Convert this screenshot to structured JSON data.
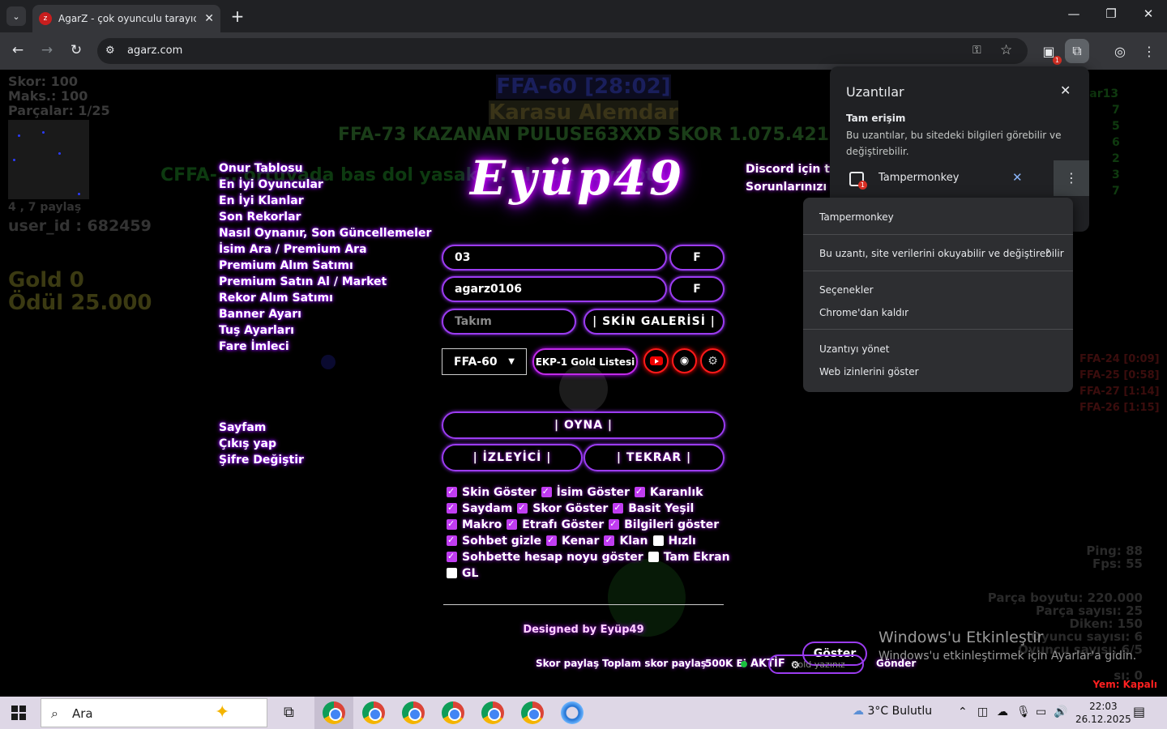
{
  "browser": {
    "tab_title": "AgarZ - çok oyunculu tarayıcı oyunu",
    "tab_close": "✕",
    "new_tab": "+",
    "url": "agarz.com",
    "window_controls": {
      "minimize": "—",
      "maximize": "❐",
      "close": "✕"
    },
    "extension_badge": "1"
  },
  "game": {
    "skor": "Skor: 100",
    "maks": "Maks.: 100",
    "parcalar": "Parçalar: 1/25",
    "share_text": "4 , 7 paylaş",
    "user_id": "user_id : 682459",
    "gold": "Gold 0",
    "odul": "Ödül 25.000",
    "server_title": "FFA-60 [28:02]",
    "karasu": "Karasu Alemdar",
    "winner_banner": "FFA-73 KAZANAN PULUSE63XXD SKOR 1.075.421",
    "ticker": "CFFA-... ortuvada bas dol yasakt... olmak veya oto",
    "logo": "Eyüp49",
    "menu_top": [
      "Onur Tablosu",
      "En İyi Oyuncular",
      "En İyi Klanlar",
      "Son Rekorlar",
      "Nasıl Oynanır, Son Güncellemeler",
      "İsim Ara / Premium Ara",
      "Premium Alım Satımı",
      "Premium Satın Al / Market",
      "Rekor Alım Satımı",
      "Banner Ayarı",
      "Tuş Ayarları",
      "Fare İmleci"
    ],
    "menu_bottom": [
      "Sayfam",
      "Çıkış yap",
      "Şifre Değiştir"
    ],
    "discord_line1": "Discord için tıkl",
    "discord_line2": "Sorunlarınızı bi",
    "tag_value": "03",
    "f_button": "F",
    "nick_value": "agarz0106",
    "team_placeholder": "Takım",
    "skin_gallery": "| SKİN GALERİSİ |",
    "server_select": "FFA-60",
    "gold_list": "EKP-1 Gold Listesi",
    "play": "| OYNA |",
    "spectate": "| İZLEYİCİ |",
    "replay": "| TEKRAR |",
    "checkbox_rows": [
      [
        {
          "label": "Skin Göster",
          "on": true
        },
        {
          "label": "İsim Göster",
          "on": true
        },
        {
          "label": "Karanlık",
          "on": true
        }
      ],
      [
        {
          "label": "Saydam",
          "on": true
        },
        {
          "label": "Skor Göster",
          "on": true
        },
        {
          "label": "Basit Yeşil",
          "on": true
        }
      ],
      [
        {
          "label": "Makro",
          "on": true
        },
        {
          "label": "Etrafı Göster",
          "on": true
        },
        {
          "label": "Bilgileri göster",
          "on": true
        }
      ],
      [
        {
          "label": "Sohbet gizle",
          "on": true
        },
        {
          "label": "Kenar",
          "on": true
        },
        {
          "label": "Klan",
          "on": true
        },
        {
          "label": "Hızlı",
          "on": false
        }
      ],
      [
        {
          "label": "Sohbette hesap noyu göster",
          "on": true
        },
        {
          "label": "Tam Ekran",
          "on": false
        }
      ],
      [
        {
          "label": "GL",
          "on": false
        }
      ]
    ],
    "designed_by": "Designed by Eyüp49",
    "skor_paylas": "Skor paylaş",
    "toplam_skor_paylas": "Toplam skor paylaş",
    "k500": "500K Ei",
    "aktif": "AKTİF",
    "chat_placeholder": "Gold yazınız",
    "gonder": "Gönder",
    "goster": "Göster",
    "leaderboard_right": [
      "aglar13",
      "7",
      "5",
      "6",
      "2",
      "3",
      "7"
    ],
    "history": [
      "FFA-24 [0:09]",
      "FFA-25 [0:58]",
      "FFA-27 [1:14]",
      "FFA-26 [1:15]"
    ],
    "ping": "Ping: 88",
    "fps": "Fps: 55",
    "parca_boyutu": "Parça boyutu: 220.000",
    "parca_sayisi": "Parça sayısı: 25",
    "diken": "Diken: 150",
    "oyuncu_sayisi": "Oyuncu sayısı: 6",
    "oyuncu_sayisi2": "Oyuncu sayısı: 6/5",
    "last_stat": "sı: 0",
    "yem": "Yem: Kapalı",
    "activate_title": "Windows'u Etkinleştir",
    "activate_sub": "Windows'u etkinleştirmek için Ayarlar'a gidin."
  },
  "extensions_popup": {
    "title": "Uzantılar",
    "close": "✕",
    "section": "Tam erişim",
    "description": "Bu uzantılar, bu sitedeki bilgileri görebilir ve değiştirebilir.",
    "extension_name": "Tampermonkey",
    "badge": "1",
    "more": "⋮"
  },
  "context_menu": {
    "items": [
      "Tampermonkey",
      "Bu uzantı, site verilerini okuyabilir ve değiştirebilir",
      "Seçenekler",
      "Chrome'dan kaldır",
      "Uzantıyı yönet",
      "Web izinlerini göster"
    ],
    "arrow": "›"
  },
  "taskbar": {
    "search_placeholder": "Ara",
    "weather": "3°C  Bulutlu",
    "time": "22:03",
    "date": "26.12.2025",
    "notif_badge": "1"
  }
}
